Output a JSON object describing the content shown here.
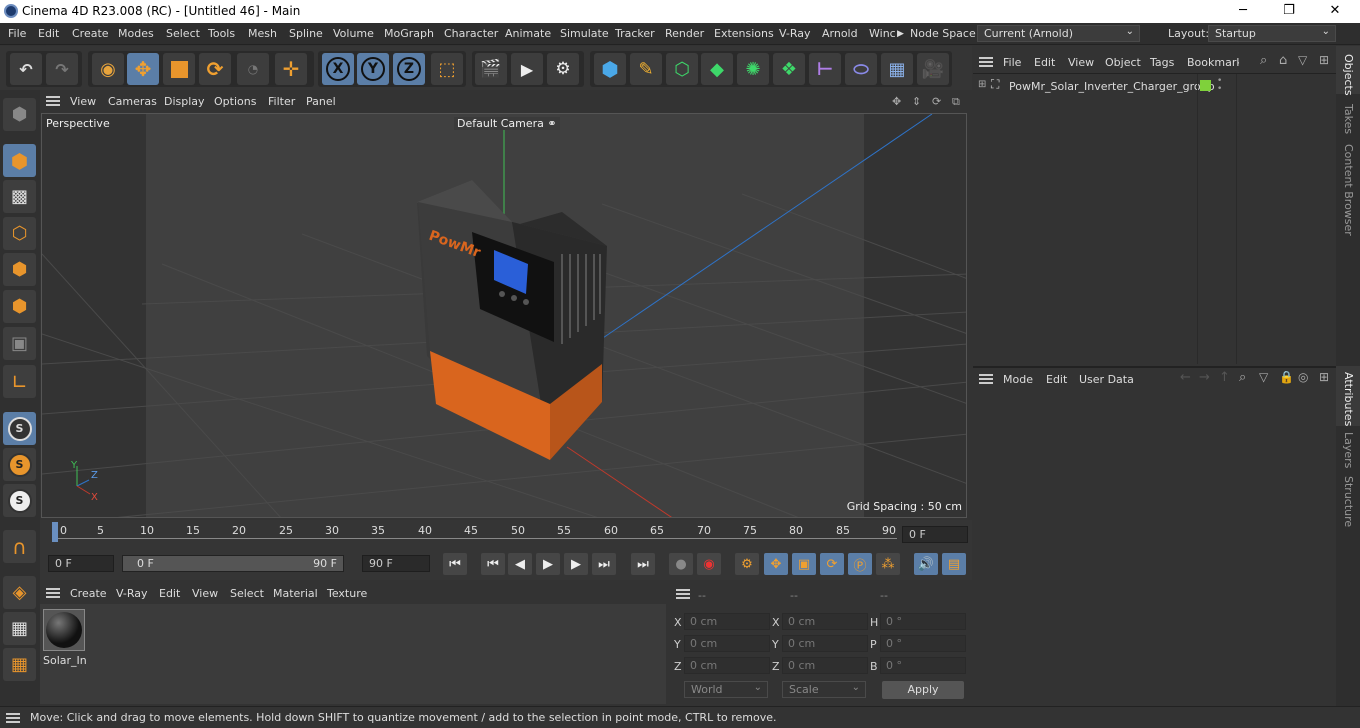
{
  "window": {
    "title": "Cinema 4D R23.008 (RC) - [Untitled 46] - Main"
  },
  "menubar": {
    "items": [
      "File",
      "Edit",
      "Create",
      "Modes",
      "Select",
      "Tools",
      "Mesh",
      "Spline",
      "Volume",
      "MoGraph",
      "Character",
      "Animate",
      "Simulate",
      "Tracker",
      "Render",
      "Extensions",
      "V-Ray",
      "Arnold",
      "Winc"
    ],
    "node_space_label": "Node Space:",
    "node_space_value": "Current (Arnold)",
    "layout_label": "Layout:",
    "layout_value": "Startup"
  },
  "viewport": {
    "menu": [
      "View",
      "Cameras",
      "Display",
      "Options",
      "Filter",
      "Panel"
    ],
    "view_name": "Perspective",
    "camera_label": "Default Camera",
    "grid_spacing": "Grid Spacing : 50 cm",
    "brand": "PowMr",
    "axis_labels": {
      "y": "Y",
      "z": "Z",
      "x": "X"
    }
  },
  "timeline": {
    "ticks": [
      "0",
      "5",
      "10",
      "15",
      "20",
      "25",
      "30",
      "35",
      "40",
      "45",
      "50",
      "55",
      "60",
      "65",
      "70",
      "75",
      "80",
      "85",
      "90"
    ],
    "current_frame": "0 F"
  },
  "transport": {
    "start": "0 F",
    "range_start": "0 F",
    "range_end": "90 F",
    "end": "90 F"
  },
  "materials": {
    "menu": [
      "Create",
      "V-Ray",
      "Edit",
      "View",
      "Select",
      "Material",
      "Texture"
    ],
    "items": [
      {
        "name": "Solar_Inv"
      }
    ]
  },
  "coords": {
    "header": [
      "--",
      "--",
      "--"
    ],
    "rows": [
      {
        "l1": "X",
        "v1": "0 cm",
        "l2": "X",
        "v2": "0 cm",
        "l3": "H",
        "v3": "0 °"
      },
      {
        "l1": "Y",
        "v1": "0 cm",
        "l2": "Y",
        "v2": "0 cm",
        "l3": "P",
        "v3": "0 °"
      },
      {
        "l1": "Z",
        "v1": "0 cm",
        "l2": "Z",
        "v2": "0 cm",
        "l3": "B",
        "v3": "0 °"
      }
    ],
    "world": "World",
    "scale": "Scale",
    "apply": "Apply"
  },
  "objects": {
    "menu": [
      "File",
      "Edit",
      "View",
      "Object",
      "Tags",
      "Bookmarks"
    ],
    "items": [
      {
        "name": "PowMr_Solar_Inverter_Charger_group"
      }
    ]
  },
  "attributes": {
    "menu": [
      "Mode",
      "Edit",
      "User Data"
    ]
  },
  "sidetabs": [
    "Objects",
    "Takes",
    "Content Browser",
    "Attributes",
    "Layers",
    "Structure"
  ],
  "status": "Move: Click and drag to move elements. Hold down SHIFT to quantize movement / add to the selection in point mode, CTRL to remove.",
  "colors": {
    "accent": "#5b7ea7",
    "orange": "#d9651e",
    "green_tag": "#7fd13b"
  }
}
